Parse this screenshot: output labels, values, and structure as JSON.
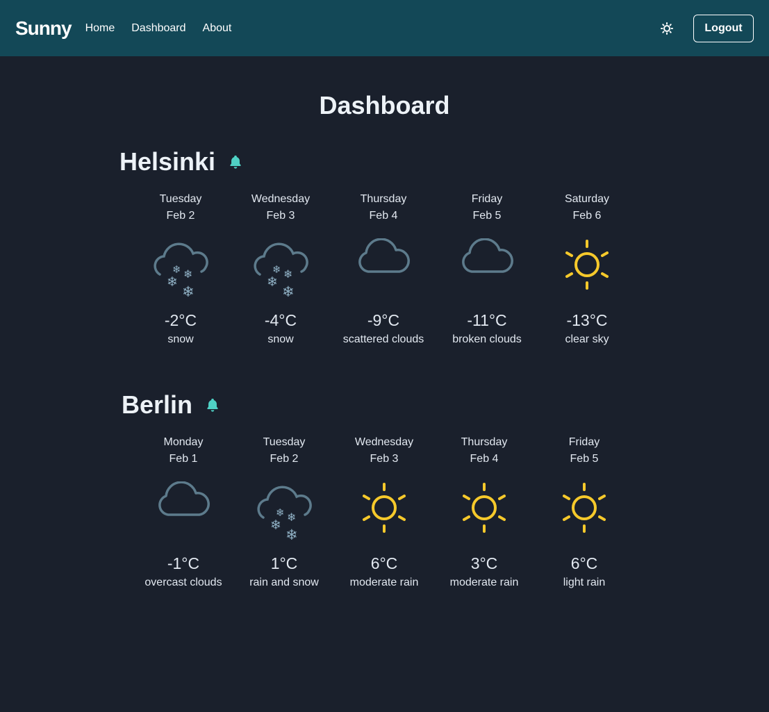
{
  "navbar": {
    "brand": "Sunny",
    "links": [
      "Home",
      "Dashboard",
      "About"
    ],
    "logout_label": "Logout"
  },
  "page": {
    "title": "Dashboard"
  },
  "cities": [
    {
      "name": "Helsinki",
      "days": [
        {
          "day": "Tuesday",
          "date": "Feb 2",
          "temp": "-2°C",
          "desc": "snow",
          "icon": "snow-icon"
        },
        {
          "day": "Wednesday",
          "date": "Feb 3",
          "temp": "-4°C",
          "desc": "snow",
          "icon": "snow-icon"
        },
        {
          "day": "Thursday",
          "date": "Feb 4",
          "temp": "-9°C",
          "desc": "scattered clouds",
          "icon": "cloud-icon"
        },
        {
          "day": "Friday",
          "date": "Feb 5",
          "temp": "-11°C",
          "desc": "broken clouds",
          "icon": "cloud-icon"
        },
        {
          "day": "Saturday",
          "date": "Feb 6",
          "temp": "-13°C",
          "desc": "clear sky",
          "icon": "sun-icon"
        }
      ]
    },
    {
      "name": "Berlin",
      "days": [
        {
          "day": "Monday",
          "date": "Feb 1",
          "temp": "-1°C",
          "desc": "overcast clouds",
          "icon": "cloud-icon"
        },
        {
          "day": "Tuesday",
          "date": "Feb 2",
          "temp": "1°C",
          "desc": "rain and snow",
          "icon": "snow-icon"
        },
        {
          "day": "Wednesday",
          "date": "Feb 3",
          "temp": "6°C",
          "desc": "moderate rain",
          "icon": "sun-icon"
        },
        {
          "day": "Thursday",
          "date": "Feb 4",
          "temp": "3°C",
          "desc": "moderate rain",
          "icon": "sun-icon"
        },
        {
          "day": "Friday",
          "date": "Feb 5",
          "temp": "6°C",
          "desc": "light rain",
          "icon": "sun-icon"
        }
      ]
    }
  ],
  "colors": {
    "navbar": "#134857",
    "background": "#1a202c",
    "bell": "#4fd1c5",
    "sun": "#f6c92b",
    "cloud": "#5d7b8c",
    "snowflake": "#8fb0c4"
  }
}
